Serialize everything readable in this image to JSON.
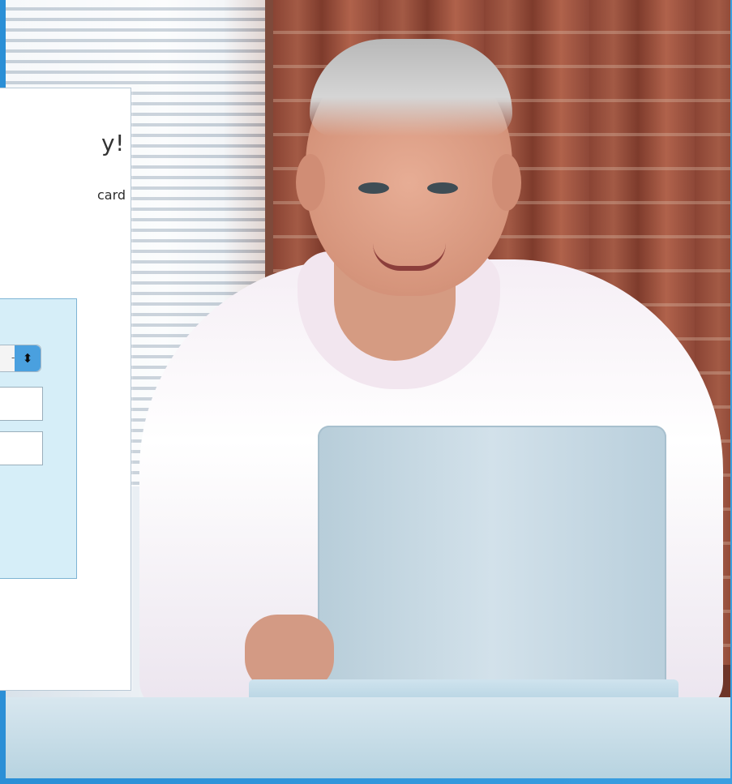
{
  "card": {
    "headline": "y!",
    "subtext": "card"
  },
  "form": {
    "select": {
      "selected_value": "-",
      "arrow_icon": "up-down-arrow-icon"
    },
    "fields": [
      {
        "value": ""
      },
      {
        "value": ""
      }
    ]
  },
  "colors": {
    "accent_blue": "#4aa0df",
    "panel_fill": "#d6eef8",
    "panel_border": "#7eb4d4"
  }
}
